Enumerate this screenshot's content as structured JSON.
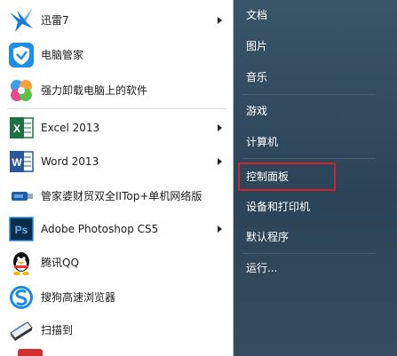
{
  "left_items": [
    {
      "label": "迅雷7",
      "icon": "thunder-bird-icon",
      "has_submenu": true
    },
    {
      "label": "电脑管家",
      "icon": "tencent-shield-icon",
      "has_submenu": false
    },
    {
      "label": "强力卸载电脑上的软件",
      "icon": "colorful-flower-icon",
      "has_submenu": false
    },
    {
      "label": "Excel 2013",
      "icon": "excel-icon",
      "has_submenu": true
    },
    {
      "label": "Word 2013",
      "icon": "word-icon",
      "has_submenu": true
    },
    {
      "label": "管家婆财贸双全IITop+单机网络版",
      "icon": "usb-key-icon",
      "has_submenu": false
    },
    {
      "label": "Adobe Photoshop CS5",
      "icon": "photoshop-icon",
      "has_submenu": true
    },
    {
      "label": "腾讯QQ",
      "icon": "qq-penguin-icon",
      "has_submenu": false
    },
    {
      "label": "搜狗高速浏览器",
      "icon": "sogou-browser-icon",
      "has_submenu": false
    },
    {
      "label": "扫描到",
      "icon": "scanner-icon",
      "has_submenu": false
    }
  ],
  "icon_letters": {
    "excel": "X",
    "word": "W",
    "photoshop": "Ps"
  },
  "right_items": [
    {
      "label": "文档"
    },
    {
      "label": "图片"
    },
    {
      "label": "音乐"
    },
    {
      "label": "游戏"
    },
    {
      "label": "计算机"
    },
    {
      "label": "控制面板"
    },
    {
      "label": "设备和打印机"
    },
    {
      "label": "默认程序"
    },
    {
      "label": "运行..."
    }
  ],
  "colors": {
    "highlight_border": "#d0242b",
    "right_pane": "#2f4a5e",
    "excel_green": "#1e7145",
    "word_blue": "#2b579a",
    "photoshop_blue": "#0b2c4a"
  }
}
